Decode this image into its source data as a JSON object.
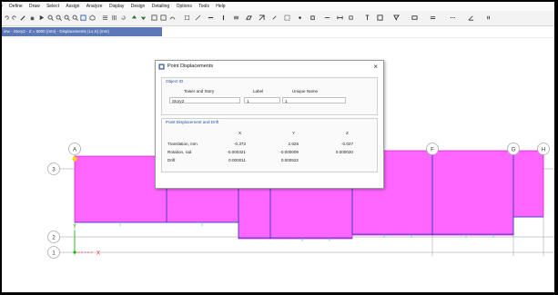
{
  "menu": {
    "items": [
      "e",
      "Define",
      "Draw",
      "Select",
      "Assign",
      "Analyze",
      "Display",
      "Design",
      "Detailing",
      "Options",
      "Tools",
      "Help"
    ]
  },
  "view_tab": {
    "label": "iew - Story2 - Z = 6000 (mm) - Displacements (Lx,X) (mm)"
  },
  "grid_bubbles": {
    "a": "A",
    "f": "F",
    "g": "G",
    "h": "H",
    "s3": "3",
    "s2": "2",
    "s1": "1"
  },
  "axes": {
    "x": "X",
    "y": "Y"
  },
  "dialog": {
    "title": "Point Displacements",
    "close_label": "×",
    "object_id": {
      "group_title": "Object ID",
      "col_tower_story": "Tower and Story",
      "col_label": "Label",
      "col_unique_name": "Unique Name",
      "story_value": "Story2",
      "label_value": "1",
      "unique_name_value": "1"
    },
    "displacement": {
      "group_title": "Point Displacement and Drift",
      "col_x": "X",
      "col_y": "Y",
      "col_z": "Z",
      "rows": [
        {
          "label": "Translation, mm",
          "x": "-0.372",
          "y": "2.625",
          "z": "-0.027"
        },
        {
          "label": "Rotation, rad",
          "x": "-0.000321",
          "y": "-0.000009",
          "z": "0.000020"
        },
        {
          "label": "Drift",
          "x": "0.000011",
          "y": "0.000522",
          "z": ""
        }
      ]
    }
  },
  "colors": {
    "diagram_fill": "#ff66ff",
    "diagram_edge": "#cc00cc",
    "beam": "#2244cc",
    "grid": "#9a9a9a",
    "bubble": "#aaaaaa",
    "y_axis": "#00bb00",
    "x_axis": "#ee2222",
    "tab": "#5b79b8",
    "group_title": "#2552a6"
  },
  "icons": [
    "new-icon",
    "open-icon",
    "edit-icon",
    "save-icon",
    "run-icon",
    "zoom-in-icon",
    "zoom-out-icon",
    "zoom-window-icon",
    "pan-icon",
    "rotate-icon",
    "view-3d-icon",
    "move-up-icon",
    "move-down-icon",
    "display-icon",
    "grid-icon",
    "section-icon",
    "deformed-icon",
    "undeformed-icon",
    "select-icon",
    "properties-icon"
  ]
}
